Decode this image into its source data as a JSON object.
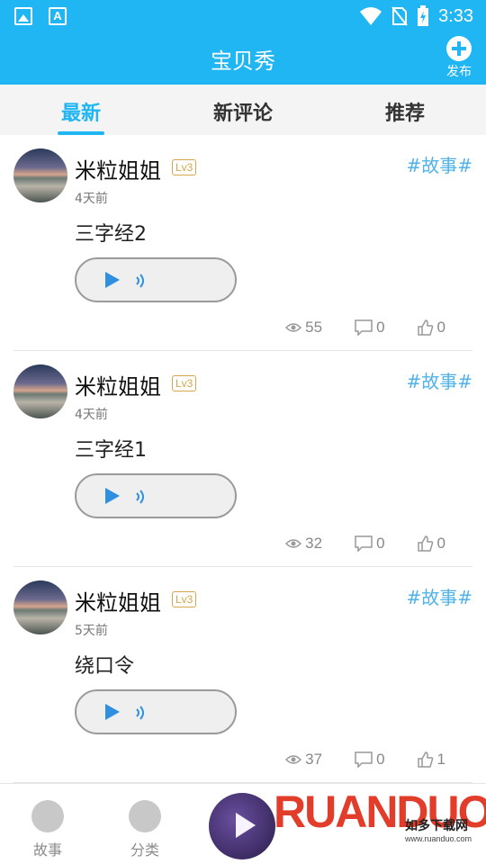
{
  "status": {
    "time": "3:33"
  },
  "header": {
    "title": "宝贝秀",
    "publish_label": "发布"
  },
  "tabs": [
    {
      "label": "最新",
      "active": true
    },
    {
      "label": "新评论",
      "active": false
    },
    {
      "label": "推荐",
      "active": false
    }
  ],
  "posts": [
    {
      "user": "米粒姐姐",
      "level": "Lv3",
      "time": "4天前",
      "title": "三字经2",
      "tag": "#故事#",
      "views": "55",
      "comments": "0",
      "likes": "0"
    },
    {
      "user": "米粒姐姐",
      "level": "Lv3",
      "time": "4天前",
      "title": "三字经1",
      "tag": "#故事#",
      "views": "32",
      "comments": "0",
      "likes": "0"
    },
    {
      "user": "米粒姐姐",
      "level": "Lv3",
      "time": "5天前",
      "title": "绕口令",
      "tag": "#故事#",
      "views": "37",
      "comments": "0",
      "likes": "1"
    }
  ],
  "bottom_nav": [
    {
      "label": "故事",
      "icon": "planet-star-icon"
    },
    {
      "label": "分类",
      "icon": "grid-icon"
    }
  ],
  "watermark": {
    "brand": "RUANDUO",
    "name": "如多下载网",
    "url": "www.ruanduo.com"
  },
  "colors": {
    "primary": "#1fb6f3",
    "tag": "#4fb3ea",
    "play": "#2f8fe0",
    "level": "#d7a54a"
  }
}
